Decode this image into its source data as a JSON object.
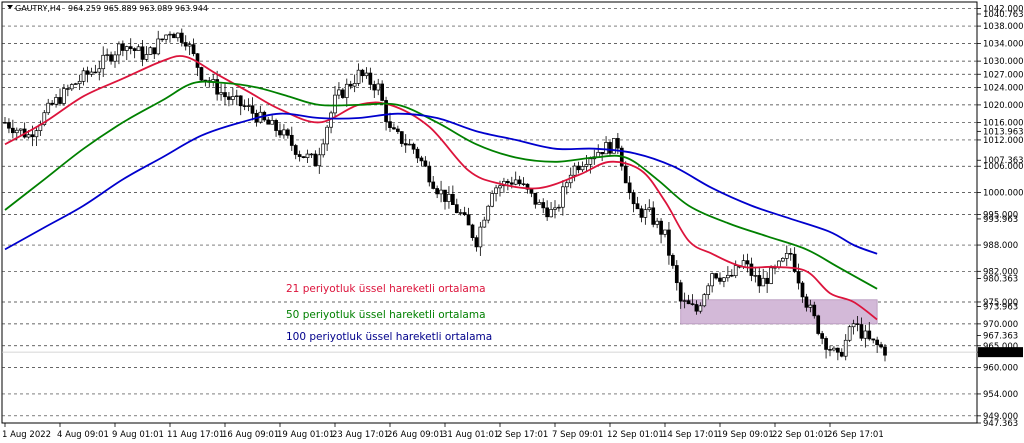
{
  "header": {
    "symbol": "GAUTRY,H4",
    "ohlc": "964.259 965.889 963.089 963.944"
  },
  "chart_data": {
    "type": "candlestick",
    "title": "",
    "ylim": [
      947.363,
      1043.5
    ],
    "y_ticks": [
      {
        "value": 1042.0,
        "label": "1042.000",
        "kind": "level"
      },
      {
        "value": 1040.763,
        "label": "1040.763",
        "kind": "label"
      },
      {
        "value": 1038.0,
        "label": "1038.000",
        "kind": "level"
      },
      {
        "value": 1034.0,
        "label": "1034.000",
        "kind": "level"
      },
      {
        "value": 1030.0,
        "label": "1030.000",
        "kind": "level"
      },
      {
        "value": 1027.0,
        "label": "1027.000",
        "kind": "level"
      },
      {
        "value": 1024.0,
        "label": "1024.000",
        "kind": "level"
      },
      {
        "value": 1020.0,
        "label": "1020.000",
        "kind": "level"
      },
      {
        "value": 1016.0,
        "label": "1016.000",
        "kind": "level"
      },
      {
        "value": 1013.963,
        "label": "1013.963",
        "kind": "label"
      },
      {
        "value": 1012.0,
        "label": "1012.000",
        "kind": "level"
      },
      {
        "value": 1007.363,
        "label": "1007.363",
        "kind": "label"
      },
      {
        "value": 1006.0,
        "label": "1006.000",
        "kind": "level"
      },
      {
        "value": 1000.0,
        "label": "1000.000",
        "kind": "level"
      },
      {
        "value": 995.0,
        "label": "995.000",
        "kind": "level"
      },
      {
        "value": 993.963,
        "label": "993.963",
        "kind": "label"
      },
      {
        "value": 988.0,
        "label": "988.000",
        "kind": "level"
      },
      {
        "value": 982.0,
        "label": "982.000",
        "kind": "level"
      },
      {
        "value": 980.363,
        "label": "980.363",
        "kind": "label"
      },
      {
        "value": 975.0,
        "label": "975.000",
        "kind": "level"
      },
      {
        "value": 973.963,
        "label": "973.963",
        "kind": "label"
      },
      {
        "value": 970.0,
        "label": "970.000",
        "kind": "level"
      },
      {
        "value": 967.363,
        "label": "967.363",
        "kind": "label"
      },
      {
        "value": 965.0,
        "label": "965.000",
        "kind": "level"
      },
      {
        "value": 963.544,
        "label": "963.544",
        "kind": "current"
      },
      {
        "value": 960.0,
        "label": "960.000",
        "kind": "level"
      },
      {
        "value": 954.0,
        "label": "954.000",
        "kind": "level"
      },
      {
        "value": 949.0,
        "label": "949.000",
        "kind": "level"
      },
      {
        "value": 947.363,
        "label": "947.363",
        "kind": "label"
      }
    ],
    "x_ticks": [
      {
        "index": 0,
        "label": "1 Aug 2022"
      },
      {
        "index": 14,
        "label": "4 Aug 09:01"
      },
      {
        "index": 28,
        "label": "9 Aug 01:01"
      },
      {
        "index": 42,
        "label": "11 Aug 17:01"
      },
      {
        "index": 56,
        "label": "16 Aug 09:01"
      },
      {
        "index": 70,
        "label": "19 Aug 01:01"
      },
      {
        "index": 84,
        "label": "23 Aug 17:01"
      },
      {
        "index": 98,
        "label": "26 Aug 09:01"
      },
      {
        "index": 112,
        "label": "31 Aug 01:01"
      },
      {
        "index": 126,
        "label": "2 Sep 17:01"
      },
      {
        "index": 140,
        "label": "7 Sep 09:01"
      },
      {
        "index": 154,
        "label": "12 Sep 01:01"
      },
      {
        "index": 168,
        "label": "14 Sep 17:01"
      },
      {
        "index": 182,
        "label": "19 Sep 09:01"
      },
      {
        "index": 196,
        "label": "22 Sep 01:01"
      },
      {
        "index": 210,
        "label": "26 Sep 17:01"
      }
    ],
    "zone": {
      "from_index": 172,
      "to_index": 222,
      "y_low": 970.0,
      "y_high": 975.5,
      "color": "#d3b9d8"
    },
    "close_path": [
      [
        0,
        1016
      ],
      [
        6,
        1013
      ],
      [
        12,
        1020
      ],
      [
        18,
        1025
      ],
      [
        24,
        1029
      ],
      [
        30,
        1034
      ],
      [
        36,
        1031
      ],
      [
        42,
        1037
      ],
      [
        46,
        1035
      ],
      [
        50,
        1027
      ],
      [
        56,
        1022
      ],
      [
        62,
        1019
      ],
      [
        66,
        1016
      ],
      [
        70,
        1014
      ],
      [
        75,
        1009
      ],
      [
        79,
        1007
      ],
      [
        84,
        1021
      ],
      [
        90,
        1027
      ],
      [
        95,
        1024
      ],
      [
        98,
        1014
      ],
      [
        104,
        1010
      ],
      [
        110,
        1001
      ],
      [
        116,
        995
      ],
      [
        120,
        989
      ],
      [
        124,
        1001
      ],
      [
        130,
        1003
      ],
      [
        136,
        997
      ],
      [
        140,
        995
      ],
      [
        144,
        1005
      ],
      [
        148,
        1008
      ],
      [
        152,
        1010
      ],
      [
        156,
        1011
      ],
      [
        160,
        996
      ],
      [
        164,
        995
      ],
      [
        168,
        990
      ],
      [
        172,
        975
      ],
      [
        176,
        973
      ],
      [
        180,
        982
      ],
      [
        184,
        980
      ],
      [
        188,
        984
      ],
      [
        192,
        979
      ],
      [
        196,
        982
      ],
      [
        200,
        986
      ],
      [
        204,
        975
      ],
      [
        208,
        967
      ],
      [
        212,
        962
      ],
      [
        216,
        970
      ],
      [
        220,
        966
      ],
      [
        224,
        964
      ]
    ],
    "candle_count": 225,
    "series": [
      {
        "name": "21 periyotluk üssel hareketli ortalama",
        "color": "#dc143c",
        "points": [
          [
            0,
            1011
          ],
          [
            10,
            1016
          ],
          [
            20,
            1022
          ],
          [
            30,
            1026
          ],
          [
            40,
            1030
          ],
          [
            46,
            1031
          ],
          [
            54,
            1027
          ],
          [
            62,
            1023
          ],
          [
            70,
            1019
          ],
          [
            80,
            1016
          ],
          [
            90,
            1020
          ],
          [
            98,
            1020
          ],
          [
            108,
            1015
          ],
          [
            118,
            1005
          ],
          [
            126,
            1002
          ],
          [
            136,
            1001
          ],
          [
            146,
            1004
          ],
          [
            154,
            1007
          ],
          [
            162,
            1005
          ],
          [
            168,
            998
          ],
          [
            174,
            989
          ],
          [
            180,
            986
          ],
          [
            188,
            983
          ],
          [
            196,
            983
          ],
          [
            204,
            982
          ],
          [
            210,
            977
          ],
          [
            216,
            975
          ],
          [
            222,
            971
          ]
        ]
      },
      {
        "name": "50 periyotluk üssel hareketli ortalama",
        "color": "#008000",
        "points": [
          [
            0,
            996
          ],
          [
            10,
            1003
          ],
          [
            20,
            1010
          ],
          [
            30,
            1016
          ],
          [
            40,
            1021
          ],
          [
            48,
            1025
          ],
          [
            56,
            1025
          ],
          [
            64,
            1024
          ],
          [
            72,
            1022
          ],
          [
            80,
            1020
          ],
          [
            90,
            1020
          ],
          [
            100,
            1020
          ],
          [
            110,
            1016
          ],
          [
            120,
            1011
          ],
          [
            130,
            1008
          ],
          [
            140,
            1007
          ],
          [
            150,
            1008
          ],
          [
            158,
            1008
          ],
          [
            166,
            1003
          ],
          [
            174,
            997
          ],
          [
            184,
            993
          ],
          [
            194,
            990
          ],
          [
            204,
            987
          ],
          [
            212,
            983
          ],
          [
            222,
            978
          ]
        ]
      },
      {
        "name": "100 periyotluk üssel hareketli ortalama",
        "color": "#0000cd",
        "points": [
          [
            0,
            987
          ],
          [
            10,
            992
          ],
          [
            20,
            997
          ],
          [
            30,
            1003
          ],
          [
            40,
            1008
          ],
          [
            50,
            1013
          ],
          [
            60,
            1016
          ],
          [
            70,
            1018
          ],
          [
            80,
            1017
          ],
          [
            90,
            1017
          ],
          [
            100,
            1018
          ],
          [
            110,
            1017
          ],
          [
            120,
            1014
          ],
          [
            130,
            1012
          ],
          [
            140,
            1010
          ],
          [
            150,
            1010
          ],
          [
            160,
            1009
          ],
          [
            170,
            1006
          ],
          [
            180,
            1001
          ],
          [
            190,
            997
          ],
          [
            200,
            994
          ],
          [
            210,
            991
          ],
          [
            216,
            988
          ],
          [
            222,
            986
          ]
        ]
      }
    ]
  },
  "legend": [
    {
      "label": "21 periyotluk üssel hareketli ortalama",
      "color": "#dc143c"
    },
    {
      "label": "50 periyotluk üssel hareketli ortalama",
      "color": "#008000"
    },
    {
      "label": "100 periyotluk üssel hareketli ortalama",
      "color": "#00008b"
    }
  ]
}
